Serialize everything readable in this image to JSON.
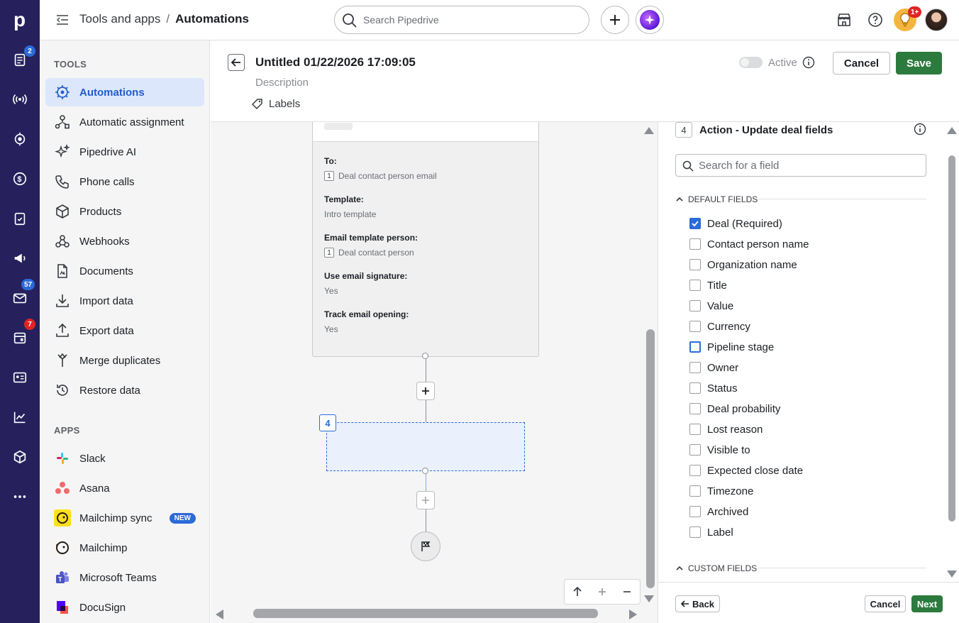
{
  "app": {
    "logo_letter": "p"
  },
  "rail": {
    "badges": {
      "leads": "2",
      "mail": "57",
      "calendar": "7"
    }
  },
  "topbar": {
    "breadcrumb_parent": "Tools and apps",
    "breadcrumb_sep": "/",
    "breadcrumb_current": "Automations",
    "search_placeholder": "Search Pipedrive",
    "notifications_badge": "1+"
  },
  "sidebar": {
    "tools_heading": "TOOLS",
    "tools": [
      {
        "label": "Automations",
        "icon": "automations-icon",
        "active": true
      },
      {
        "label": "Automatic assignment",
        "icon": "assignment-icon"
      },
      {
        "label": "Pipedrive AI",
        "icon": "sparkle-icon"
      },
      {
        "label": "Phone calls",
        "icon": "phone-icon"
      },
      {
        "label": "Products",
        "icon": "box-icon"
      },
      {
        "label": "Webhooks",
        "icon": "webhook-icon"
      },
      {
        "label": "Documents",
        "icon": "document-icon"
      },
      {
        "label": "Import data",
        "icon": "import-icon"
      },
      {
        "label": "Export data",
        "icon": "export-icon"
      },
      {
        "label": "Merge duplicates",
        "icon": "merge-icon"
      },
      {
        "label": "Restore data",
        "icon": "restore-icon"
      }
    ],
    "apps_heading": "APPS",
    "apps": [
      {
        "label": "Slack",
        "icon": "slack-icon"
      },
      {
        "label": "Asana",
        "icon": "asana-icon"
      },
      {
        "label": "Mailchimp sync",
        "icon": "mailchimp-icon",
        "badge": "NEW"
      },
      {
        "label": "Mailchimp",
        "icon": "mailchimp-icon"
      },
      {
        "label": "Microsoft Teams",
        "icon": "teams-icon"
      },
      {
        "label": "DocuSign",
        "icon": "docusign-icon"
      }
    ]
  },
  "header": {
    "title": "Untitled 01/22/2026 17:09:05",
    "description": "Description",
    "labels": "Labels",
    "active_label": "Active",
    "cancel": "Cancel",
    "save": "Save"
  },
  "canvas": {
    "card": {
      "to_label": "To:",
      "to_chip": "1",
      "to_value": "Deal contact person email",
      "template_label": "Template:",
      "template_value": "Intro template",
      "person_label": "Email template person:",
      "person_chip": "1",
      "person_value": "Deal contact person",
      "signature_label": "Use email signature:",
      "signature_value": "Yes",
      "tracking_label": "Track email opening:",
      "tracking_value": "Yes"
    },
    "new_step_number": "4"
  },
  "panel": {
    "step_number": "4",
    "title": "Action - Update deal fields",
    "search_placeholder": "Search for a field",
    "default_heading": "DEFAULT FIELDS",
    "fields": [
      {
        "label": "Deal (Required)",
        "checked": true
      },
      {
        "label": "Contact person name",
        "checked": false
      },
      {
        "label": "Organization name",
        "checked": false
      },
      {
        "label": "Title",
        "checked": false
      },
      {
        "label": "Value",
        "checked": false
      },
      {
        "label": "Currency",
        "checked": false
      },
      {
        "label": "Pipeline stage",
        "checked": false,
        "focused": true
      },
      {
        "label": "Owner",
        "checked": false
      },
      {
        "label": "Status",
        "checked": false
      },
      {
        "label": "Deal probability",
        "checked": false
      },
      {
        "label": "Lost reason",
        "checked": false
      },
      {
        "label": "Visible to",
        "checked": false
      },
      {
        "label": "Expected close date",
        "checked": false
      },
      {
        "label": "Timezone",
        "checked": false
      },
      {
        "label": "Archived",
        "checked": false
      },
      {
        "label": "Label",
        "checked": false
      }
    ],
    "custom_heading": "CUSTOM FIELDS",
    "back": "Back",
    "cancel": "Cancel",
    "next": "Next"
  },
  "colors": {
    "rail": "#26215c",
    "accent": "#2b6ad8",
    "primary_button": "#2d7a3e",
    "active_item_bg": "#dde7fb"
  }
}
